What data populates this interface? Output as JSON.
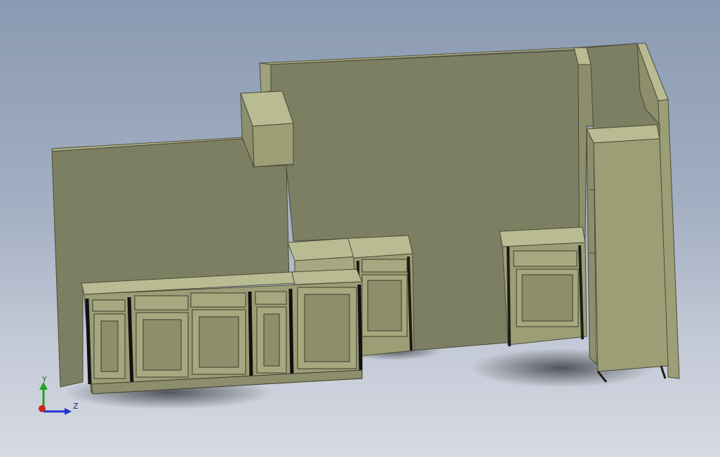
{
  "viewport": {
    "background_top": "#8a9ab2",
    "background_bottom": "#d6dae3"
  },
  "model": {
    "description_colors": {
      "wall": "#7d7f62",
      "wall_top": "#a9ab85",
      "cabinet_face": "#9c9e76",
      "cabinet_top": "#b9bb92",
      "shadow_line": "#1c1c14"
    }
  },
  "triad": {
    "y_label": "Y",
    "z_label": "Z",
    "y_color": "#22a022",
    "z_color": "#2233cc",
    "x_color": "#cc2222"
  }
}
